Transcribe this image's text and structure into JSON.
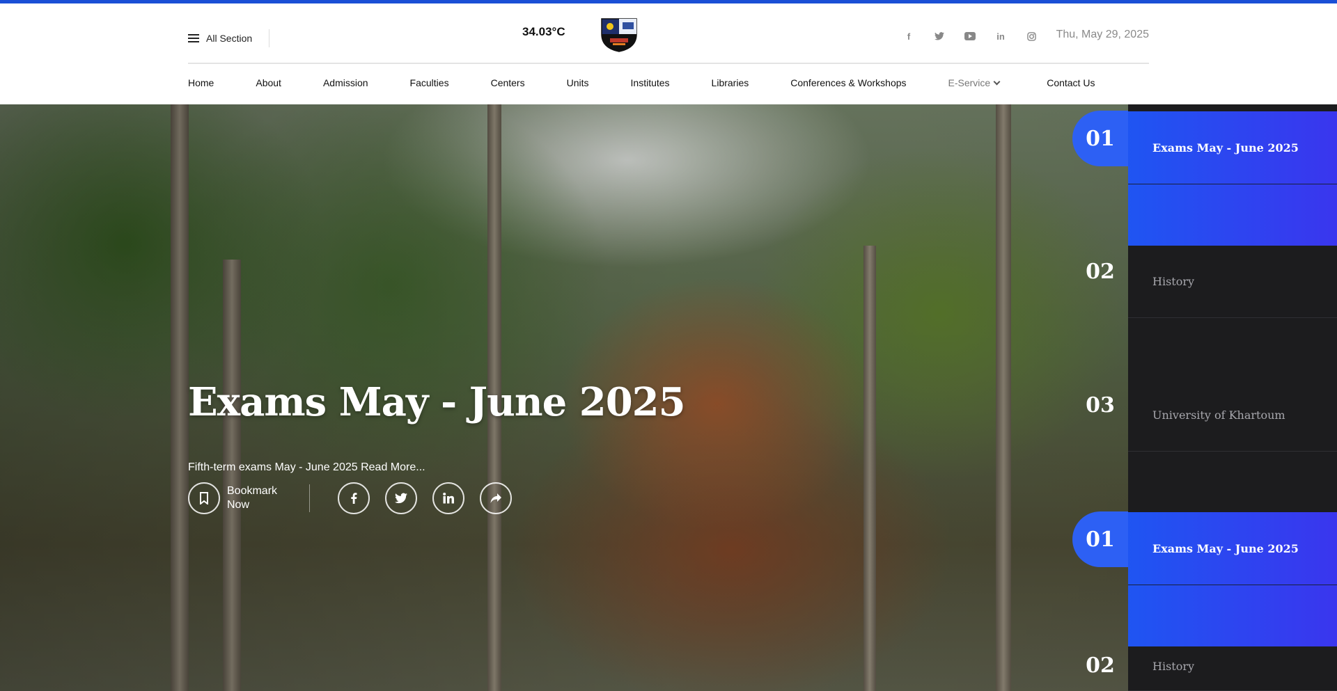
{
  "header": {
    "all_section": "All Section",
    "temperature": "34.03°C",
    "date": "Thu, May 29, 2025",
    "socials": [
      {
        "icon": "facebook-icon",
        "glyph": "f"
      },
      {
        "icon": "twitter-icon",
        "glyph": "t"
      },
      {
        "icon": "youtube-icon",
        "glyph": "▶"
      },
      {
        "icon": "linkedin-icon",
        "glyph": "in"
      },
      {
        "icon": "instagram-icon",
        "glyph": "◎"
      }
    ]
  },
  "nav": {
    "items": [
      "Home",
      "About",
      "Admission",
      "Faculties",
      "Centers",
      "Units",
      "Institutes",
      "Libraries",
      "Conferences & Workshops",
      "E-Service",
      "Contact Us"
    ]
  },
  "hero": {
    "title": "Exams May - June 2025",
    "subtitle": "Fifth-term exams May - June 2025",
    "read_more": "Read More...",
    "bookmark_line1": "Bookmark",
    "bookmark_line2": "Now"
  },
  "slider": {
    "items": [
      {
        "number": "01",
        "label": "Exams May - June 2025",
        "active": true
      },
      {
        "number": "02",
        "label": "History",
        "active": false
      },
      {
        "number": "03",
        "label": "University of Khartoum",
        "active": false
      },
      {
        "number": "01",
        "label": "Exams May - June 2025",
        "active": true
      },
      {
        "number": "02",
        "label": "History",
        "active": false
      }
    ]
  },
  "colors": {
    "accent": "#1a4fd6",
    "slider_active": "#2d60f4",
    "slider_bg": "#1c1c1e"
  }
}
